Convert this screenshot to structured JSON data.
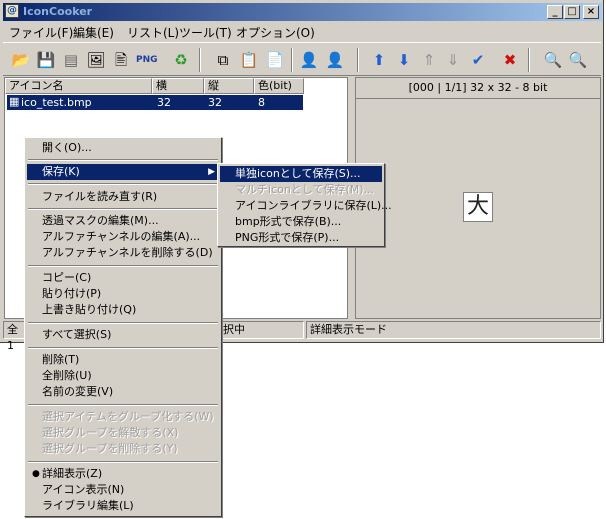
{
  "window": {
    "title": "IconCooker",
    "controls": {
      "minimize": "_",
      "maximize": "□",
      "close": "×"
    }
  },
  "menubar": [
    "ファイル(F)",
    "編集(E)",
    "リスト(L)",
    "ツール(T)",
    "オプション(O)"
  ],
  "toolbar_icons": {
    "open": "📂",
    "save": "💾",
    "png": "PNG",
    "refresh": "♻",
    "person": "👤",
    "person2": "👤",
    "up": "⬆",
    "down": "⬇",
    "check": "✔",
    "delete": "✖",
    "zoom_in": "🔍",
    "zoom_out": "🔍"
  },
  "list": {
    "columns": [
      "アイコン名",
      "横",
      "縦",
      "色(bit)"
    ],
    "rows": [
      {
        "name": "ico_test.bmp",
        "w": "32",
        "h": "32",
        "bits": "8"
      }
    ]
  },
  "preview": {
    "header": "[000 | 1/1] 32 x 32 - 8 bit",
    "glyph": "大"
  },
  "status": {
    "left": "全 1",
    "middle": "択中",
    "right": "詳細表示モード"
  },
  "context_menu": {
    "open": "開く(O)...",
    "save": "保存(K)",
    "reload": "ファイルを読み直す(R)",
    "edit_mask": "透過マスクの編集(M)...",
    "edit_alpha": "アルファチャンネルの編集(A)...",
    "delete_alpha": "アルファチャンネルを削除する(D)",
    "copy": "コピー(C)",
    "paste": "貼り付け(P)",
    "overwrite_paste": "上書き貼り付け(Q)",
    "select_all": "すべて選択(S)",
    "delete": "削除(T)",
    "delete_all": "全削除(U)",
    "rename": "名前の変更(V)",
    "group_items": "選択アイテムをグループ化する(W)",
    "ungroup": "選択グループを解散する(X)",
    "delete_group": "選択グループを削除する(Y)",
    "detail_view": "詳細表示(Z)",
    "icon_view": "アイコン表示(N)",
    "library_edit": "ライブラリ編集(L)",
    "arrow": "▶",
    "bullet": "●"
  },
  "save_submenu": {
    "single_icon": "単独iconとして保存(S)...",
    "multi_icon": "マルチiconとして保存(M)...",
    "library": "アイコンライブラリに保存(L)...",
    "bmp": "bmp形式で保存(B)...",
    "png": "PNG形式で保存(P)..."
  },
  "colors": {
    "highlight": "#0a246a",
    "face": "#d4d0c8"
  }
}
